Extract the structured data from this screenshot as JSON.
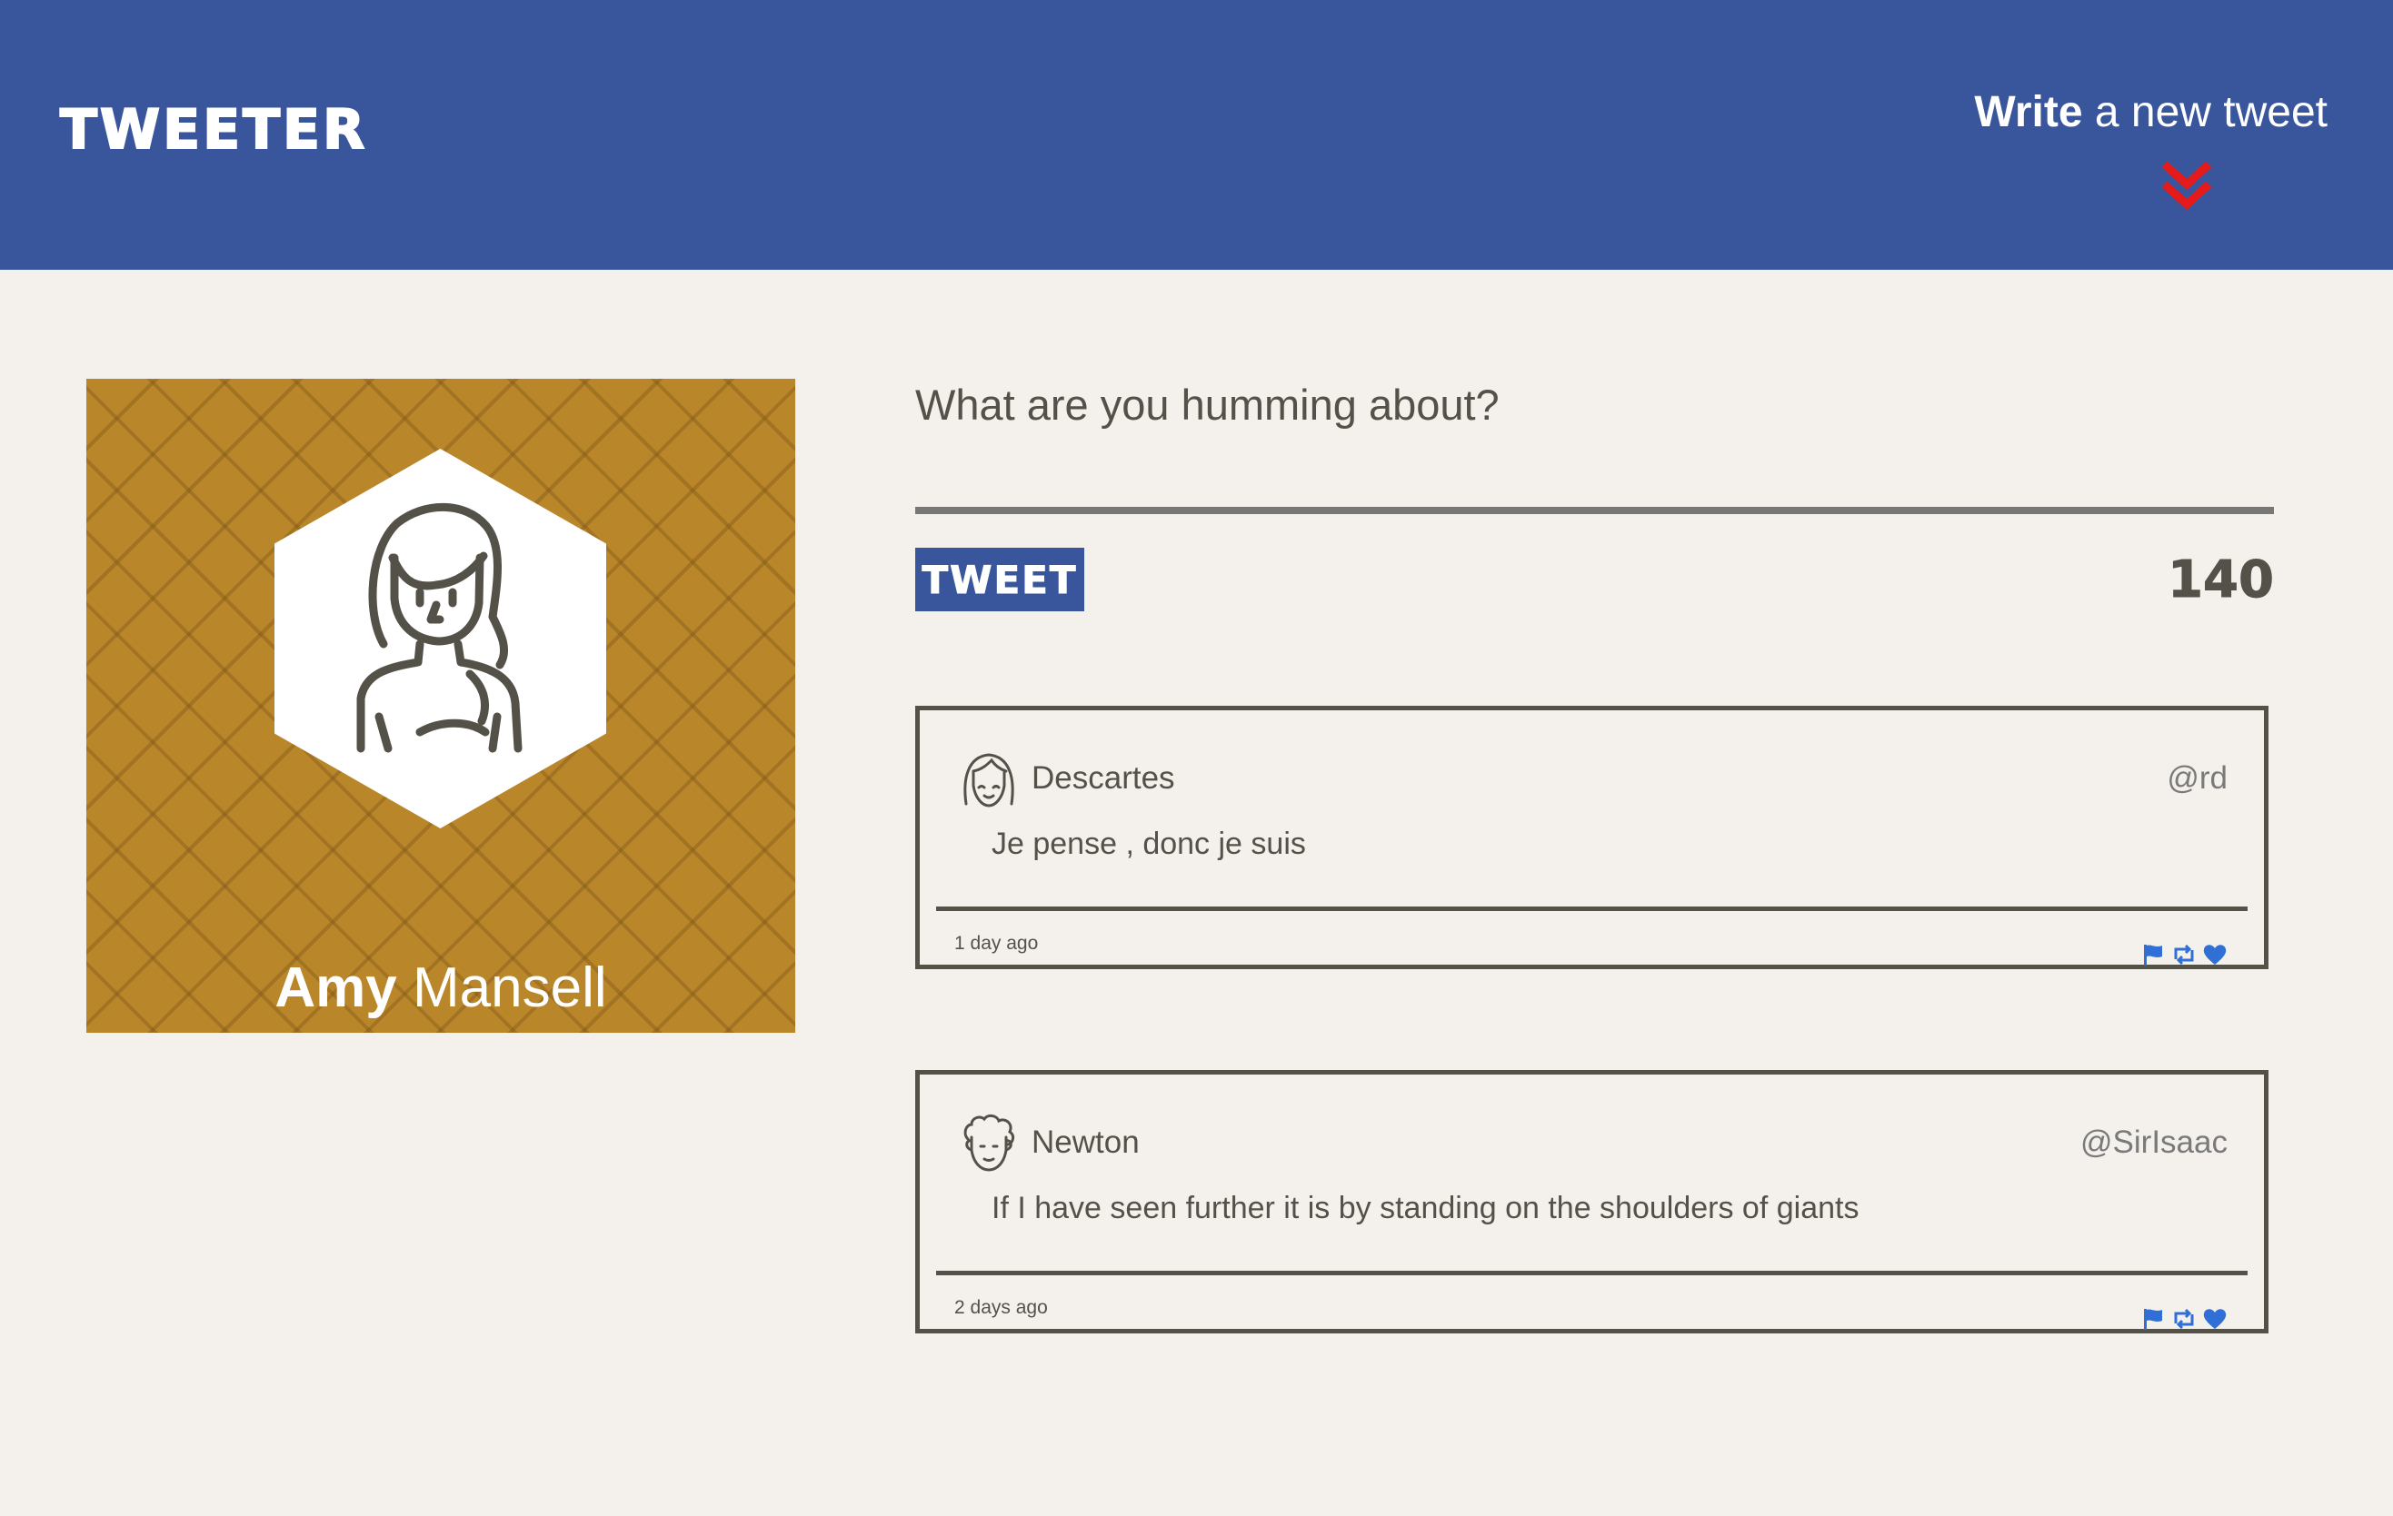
{
  "header": {
    "brand": "TWEETER",
    "compose_toggle": {
      "bold": "Write",
      "rest": " a new tweet",
      "icon": "chevron-double-down-icon"
    },
    "background_color": "#39569c",
    "accent_color": "#e51a1a"
  },
  "profile": {
    "first_name": "Amy",
    "last_name": " Mansell",
    "avatar_icon": "woman-avatar-icon",
    "background_color": "#b9862a"
  },
  "composer": {
    "heading": "What are you humming about?",
    "input_value": "",
    "button_label": "TWEET",
    "char_count": "140"
  },
  "tweets": [
    {
      "avatar_icon": "girl-avatar-icon",
      "name": "Descartes",
      "handle": "@rd",
      "text": "Je pense , donc je suis",
      "time": "1 day ago",
      "actions": [
        "flag-icon",
        "retweet-icon",
        "heart-icon"
      ]
    },
    {
      "avatar_icon": "curly-hair-man-avatar-icon",
      "name": "Newton",
      "handle": "@SirIsaac",
      "text": "If I have seen further it is by standing on the shoulders of giants",
      "time": "2 days ago",
      "actions": [
        "flag-icon",
        "retweet-icon",
        "heart-icon"
      ]
    }
  ],
  "colors": {
    "page_background": "#f4f1ec",
    "text": "#545149",
    "action_icons": "#2f6fd6"
  }
}
